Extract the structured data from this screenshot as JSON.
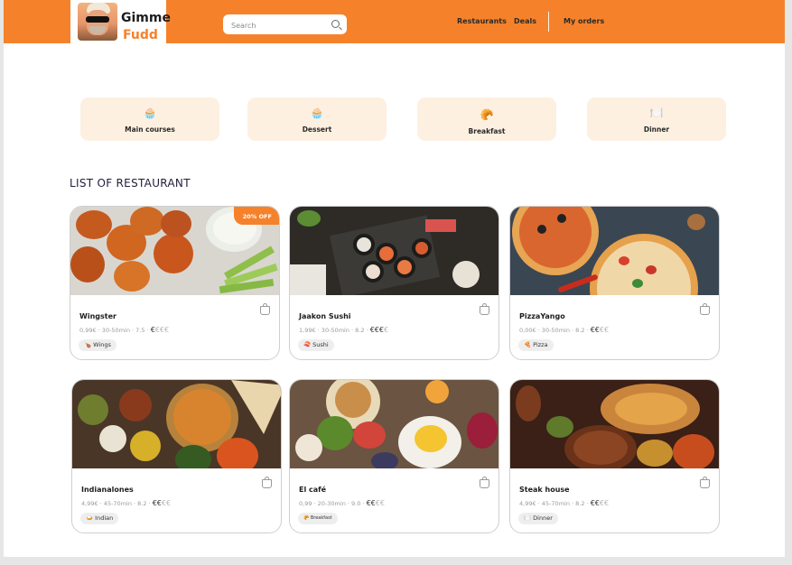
{
  "brand": {
    "line1": "Gimme",
    "line2": "Fudd"
  },
  "search": {
    "placeholder": "Search"
  },
  "nav": {
    "restaurants": "Restaurants",
    "deals": "Deals",
    "orders": "My orders"
  },
  "categories": [
    {
      "label": "Main courses",
      "icon": "🧁"
    },
    {
      "label": "Dessert",
      "icon": "🧁"
    },
    {
      "label": "Breakfast",
      "icon": "🥐"
    },
    {
      "label": "Dinner",
      "icon": "🍽️"
    }
  ],
  "section_title": "LIST OF RESTAURANT",
  "restaurants": [
    {
      "name": "Wingster",
      "meta": "0,99€ · 30-50min · 7.5 ·",
      "price_active": "€",
      "price_dim": "€€€",
      "tag": "Wings",
      "tag_icon": "🍗",
      "badge": "20% OFF"
    },
    {
      "name": "Jaakon Sushi",
      "meta": "1,99€ · 30-50min · 8.2 ·",
      "price_active": "€€€",
      "price_dim": "€",
      "tag": "Sushi",
      "tag_icon": "🍣"
    },
    {
      "name": "PizzaYango",
      "meta": "0,00€ · 30-50min · 8.2 ·",
      "price_active": "€€",
      "price_dim": "€€",
      "tag": "Pizza",
      "tag_icon": "🍕"
    },
    {
      "name": "Indianalones",
      "meta": "4,99€ · 45-70min · 8.2 ·",
      "price_active": "€€",
      "price_dim": "€€",
      "tag": "Indian",
      "tag_icon": "🍛"
    },
    {
      "name": "El café",
      "meta": "0,99 · 20-30min · 9.0 ·",
      "price_active": "€€",
      "price_dim": "€€",
      "tag": "Breakfast",
      "tag_icon": "🥐"
    },
    {
      "name": "Steak house",
      "meta": "4,99€ · 45-70min · 8.2 ·",
      "price_active": "€€",
      "price_dim": "€€",
      "tag": "Dinner",
      "tag_icon": "🍽️"
    }
  ],
  "colors": {
    "accent": "#f5822a",
    "category_bg": "#fdf0e1"
  }
}
